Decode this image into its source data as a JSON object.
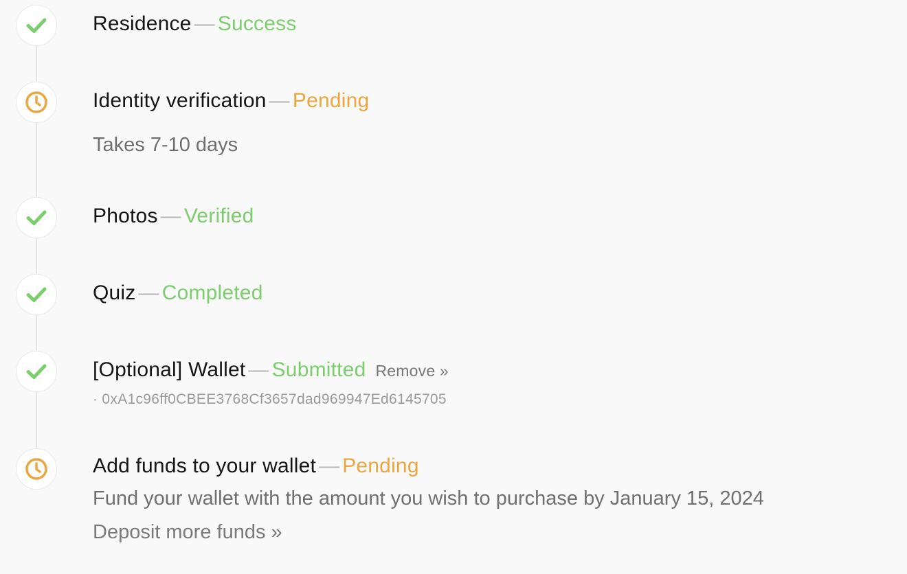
{
  "steps": [
    {
      "title": "Residence",
      "status": "Success",
      "icon": "check-icon"
    },
    {
      "title": "Identity verification",
      "status": "Pending",
      "icon": "clock-icon",
      "note": "Takes 7-10 days"
    },
    {
      "title": "Photos",
      "status": "Verified",
      "icon": "check-icon"
    },
    {
      "title": "Quiz",
      "status": "Completed",
      "icon": "check-icon"
    },
    {
      "title": "[Optional] Wallet",
      "status": "Submitted",
      "icon": "check-icon",
      "action": "Remove »",
      "address": "· 0xA1c96ff0CBEE3768Cf3657dad969947Ed6145705"
    },
    {
      "title": "Add funds to your wallet",
      "status": "Pending",
      "icon": "clock-icon",
      "note": "Fund your wallet with the amount you wish to purchase by January 15, 2024",
      "action": "Deposit more funds »"
    }
  ],
  "separator": "—",
  "colors": {
    "success": "#7ccd6d",
    "pending": "#eba640",
    "rail": "#e3e3e3",
    "background": "#f9f9f9"
  }
}
